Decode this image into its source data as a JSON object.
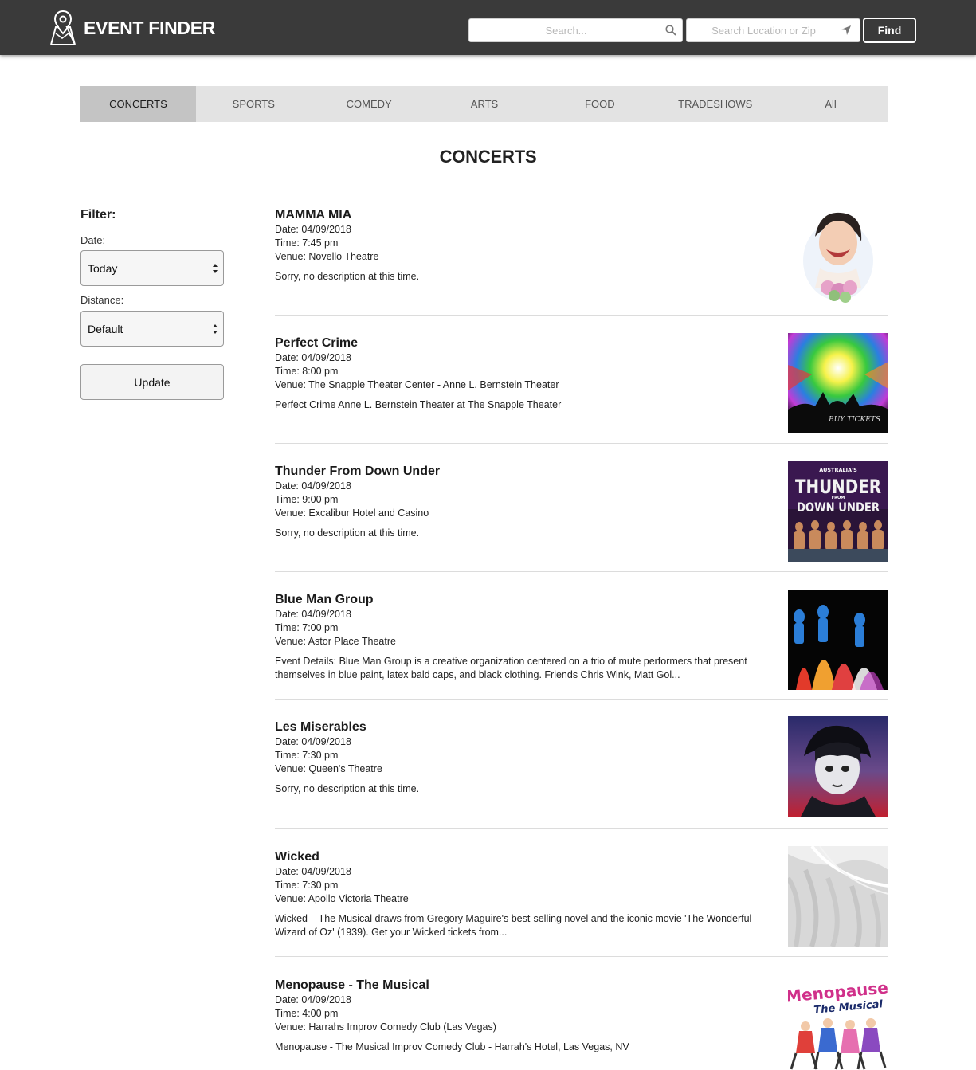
{
  "header": {
    "brand": "EVENT FINDER",
    "search_placeholder": "Search...",
    "location_placeholder": "Search Location or Zip",
    "find_label": "Find"
  },
  "tabs": [
    {
      "label": "CONCERTS",
      "active": true
    },
    {
      "label": "SPORTS",
      "active": false
    },
    {
      "label": "COMEDY",
      "active": false
    },
    {
      "label": "ARTS",
      "active": false
    },
    {
      "label": "FOOD",
      "active": false
    },
    {
      "label": "TRADESHOWS",
      "active": false
    },
    {
      "label": "All",
      "active": false
    }
  ],
  "page_title": "CONCERTS",
  "filter": {
    "title": "Filter:",
    "date_label": "Date:",
    "date_value": "Today",
    "distance_label": "Distance:",
    "distance_value": "Default",
    "update_label": "Update"
  },
  "events": [
    {
      "title": "MAMMA MIA",
      "date": "Date: 04/09/2018",
      "time": "Time: 7:45 pm",
      "venue": "Venue: Novello Theatre",
      "description": "Sorry, no description at this time."
    },
    {
      "title": "Perfect Crime",
      "date": "Date: 04/09/2018",
      "time": "Time: 8:00 pm",
      "venue": "Venue: The Snapple Theater Center - Anne L. Bernstein Theater",
      "description": "Perfect Crime Anne L. Bernstein Theater at The Snapple Theater"
    },
    {
      "title": "Thunder From Down Under",
      "date": "Date: 04/09/2018",
      "time": "Time: 9:00 pm",
      "venue": "Venue: Excalibur Hotel and Casino",
      "description": "Sorry, no description at this time."
    },
    {
      "title": "Blue Man Group",
      "date": "Date: 04/09/2018",
      "time": "Time: 7:00 pm",
      "venue": "Venue: Astor Place Theatre",
      "description": "Event Details: Blue Man Group is a creative organization centered on a trio of mute performers that present themselves in blue paint, latex bald caps, and black clothing. Friends Chris Wink, Matt Gol..."
    },
    {
      "title": "Les Miserables",
      "date": "Date: 04/09/2018",
      "time": "Time: 7:30 pm",
      "venue": "Venue: Queen's Theatre",
      "description": "Sorry, no description at this time."
    },
    {
      "title": "Wicked",
      "date": "Date: 04/09/2018",
      "time": "Time: 7:30 pm",
      "venue": "Venue: Apollo Victoria Theatre",
      "description": "Wicked – The Musical draws from Gregory Maguire's best-selling novel and the iconic movie 'The Wonderful Wizard of Oz' (1939). Get your Wicked tickets from..."
    },
    {
      "title": "Menopause - The Musical",
      "date": "Date: 04/09/2018",
      "time": "Time: 4:00 pm",
      "venue": "Venue: Harrahs Improv Comedy Club (Las Vegas)",
      "description": "Menopause - The Musical Improv Comedy Club - Harrah's Hotel, Las Vegas, NV"
    }
  ],
  "thumb_text": {
    "perfect_crime": "BUY TICKETS",
    "thunder_top": "AUSTRALIA'S",
    "thunder_main": "THUNDER",
    "thunder_from": "FROM",
    "thunder_bottom": "DOWN UNDER",
    "menopause_main": "Menopause",
    "menopause_sub": "The Musical"
  },
  "colors": {
    "header_bg": "#3a3a3a",
    "tab_bar": "#e3e3e3",
    "tab_active": "#c4c4c4"
  }
}
